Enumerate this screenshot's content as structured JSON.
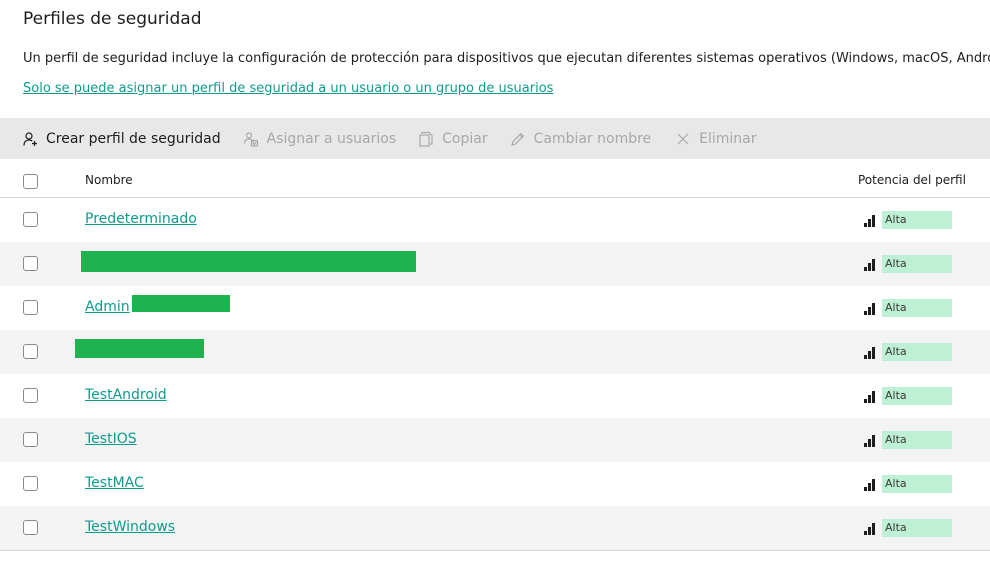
{
  "page": {
    "title": "Perfiles de seguridad",
    "description": "Un perfil de seguridad incluye la configuración de protección para dispositivos que ejecutan diferentes sistemas operativos (Windows, macOS, Android, iOS",
    "info_link": "Solo se puede asignar un perfil de seguridad a un usuario o un grupo de usuarios"
  },
  "toolbar": {
    "create_label": "Crear perfil de seguridad",
    "assign_label": "Asignar a usuarios",
    "copy_label": "Copiar",
    "rename_label": "Cambiar nombre",
    "delete_label": "Eliminar"
  },
  "table": {
    "columns": {
      "name": "Nombre",
      "strength": "Potencia del perfil"
    },
    "rows": [
      {
        "name": "Predeterminado",
        "strength": "Alta",
        "redacted": false
      },
      {
        "name": "",
        "strength": "Alta",
        "redacted": true
      },
      {
        "name": "Admin",
        "strength": "Alta",
        "redacted": "partial"
      },
      {
        "name": "",
        "strength": "Alta",
        "redacted": true
      },
      {
        "name": "TestAndroid",
        "strength": "Alta",
        "redacted": false
      },
      {
        "name": "TestIOS",
        "strength": "Alta",
        "redacted": false
      },
      {
        "name": "TestMAC",
        "strength": "Alta",
        "redacted": false
      },
      {
        "name": "TestWindows",
        "strength": "Alta",
        "redacted": false
      }
    ]
  },
  "icons": {
    "create": "add-user-icon",
    "assign": "assign-users-icon",
    "copy": "copy-icon",
    "rename": "pencil-icon",
    "delete": "close-icon",
    "strength": "signal-bars-icon"
  },
  "colors": {
    "link": "#0f9b8e",
    "badge_high": "#bdf0d4",
    "toolbar_bg": "#e8e8e8",
    "redaction": "#1fb24e"
  }
}
